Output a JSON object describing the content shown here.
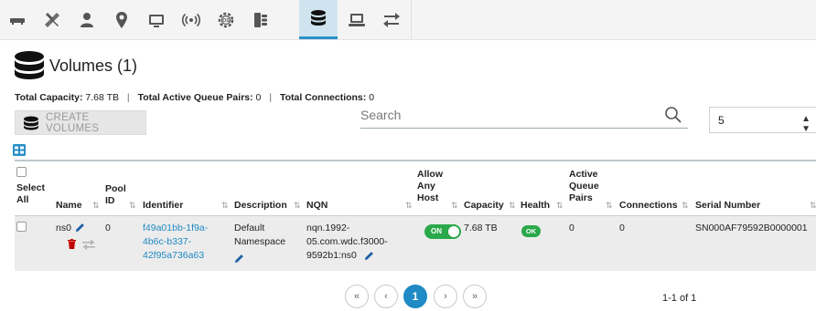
{
  "toolbar": {
    "tabs": [
      {
        "icon": "network-card-icon"
      },
      {
        "icon": "tools-icon"
      },
      {
        "icon": "user-icon"
      },
      {
        "icon": "location-pin-icon"
      },
      {
        "icon": "monitor-icon"
      },
      {
        "icon": "wireless-icon"
      },
      {
        "icon": "os-gear-icon"
      },
      {
        "icon": "server-icon"
      },
      {
        "icon": "database-icon",
        "active": true
      },
      {
        "icon": "laptop-icon"
      },
      {
        "icon": "transfer-arrows-icon"
      }
    ]
  },
  "page": {
    "title": "Volumes (1)",
    "stats": {
      "capacity_label": "Total Capacity:",
      "capacity_value": "7.68 TB",
      "queue_label": "Total Active Queue Pairs:",
      "queue_value": "0",
      "connections_label": "Total Connections:",
      "connections_value": "0",
      "separator": "|"
    },
    "create_button": "CREATE VOLUMES",
    "search": {
      "placeholder": "Search",
      "value": ""
    },
    "page_size": "5"
  },
  "table": {
    "headers": {
      "select_all": "Select All",
      "name": "Name",
      "pool_id": "Pool ID",
      "identifier": "Identifier",
      "description": "Description",
      "nqn": "NQN",
      "allow_any_host": "Allow Any Host",
      "capacity": "Capacity",
      "health": "Health",
      "active_queue_pairs": "Active Queue Pairs",
      "connections": "Connections",
      "serial_number": "Serial Number"
    },
    "rows": [
      {
        "name": "ns0",
        "pool_id": "0",
        "identifier": "f49a01bb-1f9a-4b6c-b337-42f95a736a63",
        "identifier_lines": [
          "f49a01bb-1f9a-",
          "4b6c-b337-",
          "42f95a736a63"
        ],
        "description_lines": [
          "Default",
          "Namespace"
        ],
        "nqn_lines": [
          "nqn.1992-",
          "05.com.wdc.f3000-",
          "9592b1:ns0"
        ],
        "allow_any_host": "ON",
        "capacity": "7.68 TB",
        "health": "OK",
        "active_queue_pairs": "0",
        "connections": "0",
        "serial_number": "SN000AF79592B0000001"
      }
    ]
  },
  "pagination": {
    "first": "«",
    "prev": "‹",
    "current": "1",
    "next": "›",
    "last": "»",
    "range": "1-1 of 1"
  },
  "colors": {
    "accent": "#1f8ac4",
    "active_tab": "#cfe4ee",
    "ok_green": "#2aa84a",
    "delete_red": "#c00000"
  }
}
